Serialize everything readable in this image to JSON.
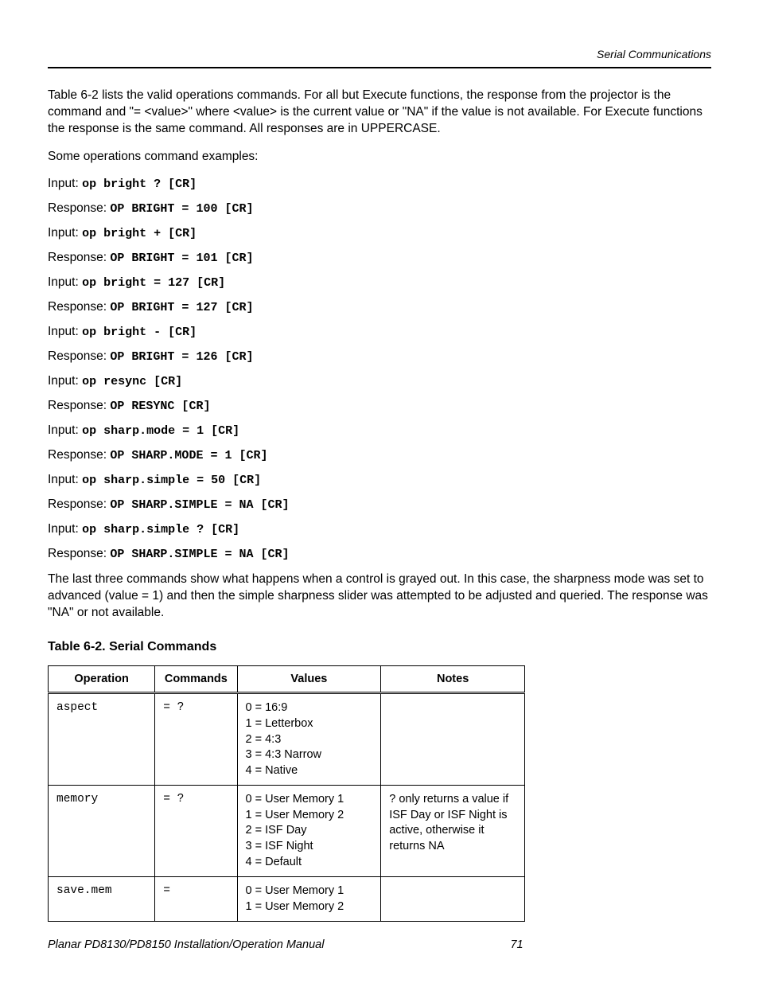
{
  "header": {
    "section": "Serial Communications"
  },
  "intro_para": "Table 6-2 lists the valid operations commands. For all but Execute functions, the response from the projector is the command and \"= <value>\" where <value> is the current value or \"NA\" if the value is not available.  For Execute functions the response is the same command.  All responses are in UPPERCASE.",
  "examples_lead": "Some operations command examples:",
  "examples": [
    {
      "label": "Input: ",
      "cmd": "op bright ? [CR]"
    },
    {
      "label": "Response: ",
      "cmd": "OP BRIGHT = 100 [CR]"
    },
    {
      "label": "Input: ",
      "cmd": "op bright + [CR]"
    },
    {
      "label": "Response: ",
      "cmd": "OP BRIGHT = 101 [CR]"
    },
    {
      "label": "Input: ",
      "cmd": "op bright = 127 [CR]"
    },
    {
      "label": "Response: ",
      "cmd": "OP BRIGHT = 127 [CR]"
    },
    {
      "label": "Input: ",
      "cmd": "op bright - [CR]"
    },
    {
      "label": "Response: ",
      "cmd": "OP BRIGHT = 126 [CR]"
    },
    {
      "label": "Input: ",
      "cmd": "op resync [CR]"
    },
    {
      "label": "Response: ",
      "cmd": "OP RESYNC [CR]"
    },
    {
      "label": "Input: ",
      "cmd": "op sharp.mode = 1 [CR]"
    },
    {
      "label": "Response: ",
      "cmd": "OP SHARP.MODE = 1 [CR]"
    },
    {
      "label": "Input: ",
      "cmd": "op sharp.simple = 50 [CR]"
    },
    {
      "label": "Response: ",
      "cmd": "OP SHARP.SIMPLE = NA [CR]"
    },
    {
      "label": "Input: ",
      "cmd": "op sharp.simple ? [CR]"
    },
    {
      "label": "Response: ",
      "cmd": "OP SHARP.SIMPLE = NA [CR]"
    }
  ],
  "outro_para": "The last three commands show what happens when a control is grayed out.  In this case, the sharpness mode was set to advanced (value = 1) and then the simple sharpness slider was attempted to be adjusted and queried.  The response was \"NA\" or not available.",
  "table": {
    "title": "Table 6-2. Serial Commands",
    "headers": {
      "op": "Operation",
      "cmds": "Commands",
      "vals": "Values",
      "notes": "Notes"
    },
    "rows": [
      {
        "op": "aspect",
        "cmds": "= ?",
        "vals": "0 = 16:9\n1 = Letterbox\n2 = 4:3\n3 = 4:3 Narrow\n4 = Native",
        "notes": ""
      },
      {
        "op": "memory",
        "cmds": "= ?",
        "vals": "0 = User Memory 1\n1 = User Memory 2\n2 = ISF Day\n3 = ISF Night\n4 = Default",
        "notes": "? only returns a value if ISF Day or ISF Night is active, otherwise it returns NA"
      },
      {
        "op": "save.mem",
        "cmds": "=",
        "vals": "0 = User Memory 1\n1 = User Memory 2",
        "notes": ""
      }
    ]
  },
  "footer": {
    "manual": "Planar PD8130/PD8150 Installation/Operation Manual",
    "page": "71"
  }
}
